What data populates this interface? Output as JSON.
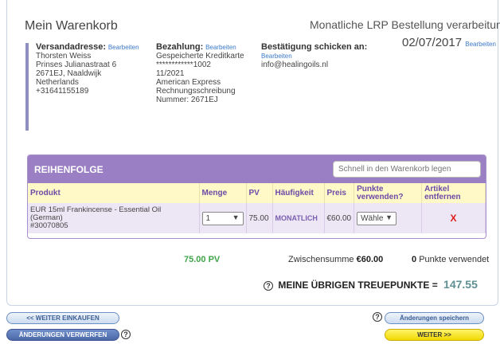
{
  "header": {
    "cart_title": "Mein Warenkorb",
    "order_type": "Monatliche LRP Bestellung verarbeitung",
    "date": "02/07/2017",
    "date_edit": "Bearbeiten"
  },
  "shipping": {
    "heading": "Versandadresse:",
    "edit": "Bearbeiten",
    "lines": [
      "Thorsten Weiss",
      "Prinses Julianastraat 6",
      "2671EJ, Naaldwijk",
      "Netherlands",
      "+31641155189"
    ]
  },
  "payment": {
    "heading": "Bezahlung:",
    "edit": "Bearbeiten",
    "lines": [
      "Gespeicherte Kreditkarte",
      "************1002",
      "11/2021",
      "American Express",
      "Rechnungsschreibung",
      "Nummer: 2671EJ"
    ]
  },
  "confirmation": {
    "heading": "Bestätigung schicken an:",
    "edit": "Bearbeiten",
    "email": "info@healingoils.nl"
  },
  "cart": {
    "section_label": "REIHENFOLGE",
    "quick_add_placeholder": "Schnell in den Warenkorb legen",
    "columns": {
      "product": "Produkt",
      "quantity": "Menge",
      "pv": "PV",
      "frequency": "Häufigkeit",
      "price": "Preis",
      "use_points": "Punkte verwenden?",
      "remove": "Artikel entfernen"
    },
    "rows": [
      {
        "product_line1": "EUR 15ml Frankincense - Essential Oil",
        "product_line2": "(German)",
        "product_line3": "#30070805",
        "quantity": "1",
        "pv": "75.00",
        "frequency": "MONATLICH",
        "price": "€60.00",
        "points_select": "Wähle",
        "remove": "X"
      }
    ]
  },
  "totals": {
    "pv": "75.00 PV",
    "subtotal_label": "Zwischensumme",
    "subtotal_value": "€60.00",
    "points_used_value": "0",
    "points_used_label": "Punkte verwendet"
  },
  "loyalty": {
    "label": "MEINE ÜBRIGEN TREUEPUNKTE =",
    "points": "147.55"
  },
  "buttons": {
    "continue_shopping": "<< WEITER EINKAUFEN",
    "discard_changes": "ÄNDERUNGEN VERWERFEN",
    "save_changes": "Änderungen speichern",
    "next": "WEITER >>"
  },
  "icons": {
    "help": "?",
    "dropdown": "▼"
  },
  "colors": {
    "cart_header": "#9b7fc4",
    "table_header_bg": "#fef9c6",
    "row_bg": "#ede6f5",
    "pv_green": "#3fa54a",
    "remove_red": "#e01b1b",
    "edit_link": "#3b79c8"
  }
}
